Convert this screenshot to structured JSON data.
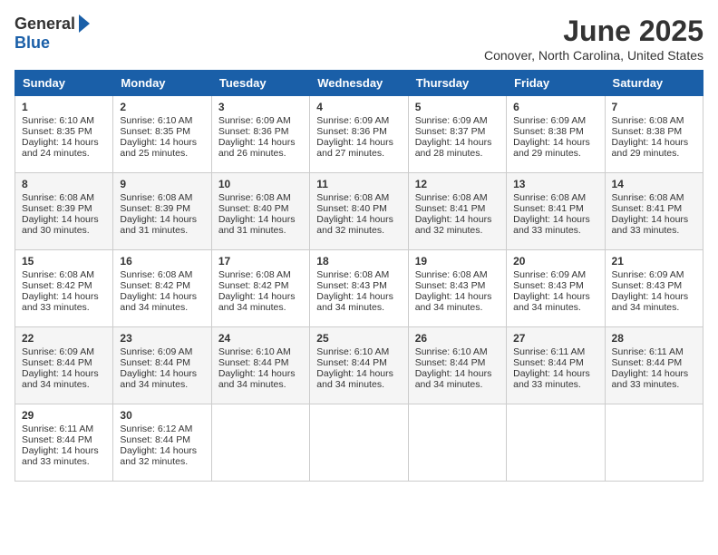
{
  "logo": {
    "general": "General",
    "blue": "Blue"
  },
  "title": "June 2025",
  "subtitle": "Conover, North Carolina, United States",
  "days": [
    "Sunday",
    "Monday",
    "Tuesday",
    "Wednesday",
    "Thursday",
    "Friday",
    "Saturday"
  ],
  "weeks": [
    [
      {
        "num": "1",
        "sunrise": "Sunrise: 6:10 AM",
        "sunset": "Sunset: 8:35 PM",
        "daylight": "Daylight: 14 hours and 24 minutes."
      },
      {
        "num": "2",
        "sunrise": "Sunrise: 6:10 AM",
        "sunset": "Sunset: 8:35 PM",
        "daylight": "Daylight: 14 hours and 25 minutes."
      },
      {
        "num": "3",
        "sunrise": "Sunrise: 6:09 AM",
        "sunset": "Sunset: 8:36 PM",
        "daylight": "Daylight: 14 hours and 26 minutes."
      },
      {
        "num": "4",
        "sunrise": "Sunrise: 6:09 AM",
        "sunset": "Sunset: 8:36 PM",
        "daylight": "Daylight: 14 hours and 27 minutes."
      },
      {
        "num": "5",
        "sunrise": "Sunrise: 6:09 AM",
        "sunset": "Sunset: 8:37 PM",
        "daylight": "Daylight: 14 hours and 28 minutes."
      },
      {
        "num": "6",
        "sunrise": "Sunrise: 6:09 AM",
        "sunset": "Sunset: 8:38 PM",
        "daylight": "Daylight: 14 hours and 29 minutes."
      },
      {
        "num": "7",
        "sunrise": "Sunrise: 6:08 AM",
        "sunset": "Sunset: 8:38 PM",
        "daylight": "Daylight: 14 hours and 29 minutes."
      }
    ],
    [
      {
        "num": "8",
        "sunrise": "Sunrise: 6:08 AM",
        "sunset": "Sunset: 8:39 PM",
        "daylight": "Daylight: 14 hours and 30 minutes."
      },
      {
        "num": "9",
        "sunrise": "Sunrise: 6:08 AM",
        "sunset": "Sunset: 8:39 PM",
        "daylight": "Daylight: 14 hours and 31 minutes."
      },
      {
        "num": "10",
        "sunrise": "Sunrise: 6:08 AM",
        "sunset": "Sunset: 8:40 PM",
        "daylight": "Daylight: 14 hours and 31 minutes."
      },
      {
        "num": "11",
        "sunrise": "Sunrise: 6:08 AM",
        "sunset": "Sunset: 8:40 PM",
        "daylight": "Daylight: 14 hours and 32 minutes."
      },
      {
        "num": "12",
        "sunrise": "Sunrise: 6:08 AM",
        "sunset": "Sunset: 8:41 PM",
        "daylight": "Daylight: 14 hours and 32 minutes."
      },
      {
        "num": "13",
        "sunrise": "Sunrise: 6:08 AM",
        "sunset": "Sunset: 8:41 PM",
        "daylight": "Daylight: 14 hours and 33 minutes."
      },
      {
        "num": "14",
        "sunrise": "Sunrise: 6:08 AM",
        "sunset": "Sunset: 8:41 PM",
        "daylight": "Daylight: 14 hours and 33 minutes."
      }
    ],
    [
      {
        "num": "15",
        "sunrise": "Sunrise: 6:08 AM",
        "sunset": "Sunset: 8:42 PM",
        "daylight": "Daylight: 14 hours and 33 minutes."
      },
      {
        "num": "16",
        "sunrise": "Sunrise: 6:08 AM",
        "sunset": "Sunset: 8:42 PM",
        "daylight": "Daylight: 14 hours and 34 minutes."
      },
      {
        "num": "17",
        "sunrise": "Sunrise: 6:08 AM",
        "sunset": "Sunset: 8:42 PM",
        "daylight": "Daylight: 14 hours and 34 minutes."
      },
      {
        "num": "18",
        "sunrise": "Sunrise: 6:08 AM",
        "sunset": "Sunset: 8:43 PM",
        "daylight": "Daylight: 14 hours and 34 minutes."
      },
      {
        "num": "19",
        "sunrise": "Sunrise: 6:08 AM",
        "sunset": "Sunset: 8:43 PM",
        "daylight": "Daylight: 14 hours and 34 minutes."
      },
      {
        "num": "20",
        "sunrise": "Sunrise: 6:09 AM",
        "sunset": "Sunset: 8:43 PM",
        "daylight": "Daylight: 14 hours and 34 minutes."
      },
      {
        "num": "21",
        "sunrise": "Sunrise: 6:09 AM",
        "sunset": "Sunset: 8:43 PM",
        "daylight": "Daylight: 14 hours and 34 minutes."
      }
    ],
    [
      {
        "num": "22",
        "sunrise": "Sunrise: 6:09 AM",
        "sunset": "Sunset: 8:44 PM",
        "daylight": "Daylight: 14 hours and 34 minutes."
      },
      {
        "num": "23",
        "sunrise": "Sunrise: 6:09 AM",
        "sunset": "Sunset: 8:44 PM",
        "daylight": "Daylight: 14 hours and 34 minutes."
      },
      {
        "num": "24",
        "sunrise": "Sunrise: 6:10 AM",
        "sunset": "Sunset: 8:44 PM",
        "daylight": "Daylight: 14 hours and 34 minutes."
      },
      {
        "num": "25",
        "sunrise": "Sunrise: 6:10 AM",
        "sunset": "Sunset: 8:44 PM",
        "daylight": "Daylight: 14 hours and 34 minutes."
      },
      {
        "num": "26",
        "sunrise": "Sunrise: 6:10 AM",
        "sunset": "Sunset: 8:44 PM",
        "daylight": "Daylight: 14 hours and 34 minutes."
      },
      {
        "num": "27",
        "sunrise": "Sunrise: 6:11 AM",
        "sunset": "Sunset: 8:44 PM",
        "daylight": "Daylight: 14 hours and 33 minutes."
      },
      {
        "num": "28",
        "sunrise": "Sunrise: 6:11 AM",
        "sunset": "Sunset: 8:44 PM",
        "daylight": "Daylight: 14 hours and 33 minutes."
      }
    ],
    [
      {
        "num": "29",
        "sunrise": "Sunrise: 6:11 AM",
        "sunset": "Sunset: 8:44 PM",
        "daylight": "Daylight: 14 hours and 33 minutes."
      },
      {
        "num": "30",
        "sunrise": "Sunrise: 6:12 AM",
        "sunset": "Sunset: 8:44 PM",
        "daylight": "Daylight: 14 hours and 32 minutes."
      },
      null,
      null,
      null,
      null,
      null
    ]
  ]
}
